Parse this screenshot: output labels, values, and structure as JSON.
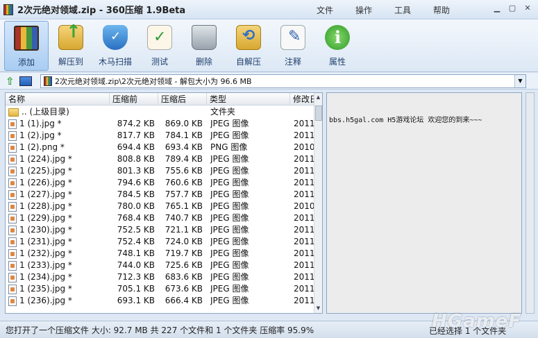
{
  "window": {
    "title": "2次元绝对领域.zip - 360压缩 1.9Beta"
  },
  "menu": [
    "文件",
    "操作",
    "工具",
    "帮助"
  ],
  "toolbar": [
    {
      "label": "添加",
      "icon": "add-archive-icon"
    },
    {
      "label": "解压到",
      "icon": "extract-folder-icon"
    },
    {
      "label": "木马扫描",
      "icon": "shield-scan-icon"
    },
    {
      "label": "测试",
      "icon": "test-checklist-icon"
    },
    {
      "label": "删除",
      "icon": "trash-can-icon"
    },
    {
      "label": "自解压",
      "icon": "self-extract-icon"
    },
    {
      "label": "注释",
      "icon": "comment-pen-icon"
    },
    {
      "label": "属性",
      "icon": "info-icon"
    }
  ],
  "address": {
    "path": "2次元绝对领域.zip\\2次元绝对领域 - 解包大小为 96.6 MB"
  },
  "list": {
    "columns": [
      "名称",
      "压缩前",
      "压缩后",
      "类型",
      "修改日"
    ],
    "rows": [
      {
        "name": ".. (上级目录)",
        "size": "",
        "packed": "",
        "type": "文件夹",
        "date": "",
        "folder": true
      },
      {
        "name": "1 (1).jpg *",
        "size": "874.2 KB",
        "packed": "869.0 KB",
        "type": "JPEG 图像",
        "date": "2011"
      },
      {
        "name": "1 (2).jpg *",
        "size": "817.7 KB",
        "packed": "784.1 KB",
        "type": "JPEG 图像",
        "date": "2011"
      },
      {
        "name": "1 (2).png *",
        "size": "694.4 KB",
        "packed": "693.4 KB",
        "type": "PNG 图像",
        "date": "2010"
      },
      {
        "name": "1 (224).jpg *",
        "size": "808.8 KB",
        "packed": "789.4 KB",
        "type": "JPEG 图像",
        "date": "2011"
      },
      {
        "name": "1 (225).jpg *",
        "size": "801.3 KB",
        "packed": "755.6 KB",
        "type": "JPEG 图像",
        "date": "2011"
      },
      {
        "name": "1 (226).jpg *",
        "size": "794.6 KB",
        "packed": "760.6 KB",
        "type": "JPEG 图像",
        "date": "2011"
      },
      {
        "name": "1 (227).jpg *",
        "size": "784.5 KB",
        "packed": "757.7 KB",
        "type": "JPEG 图像",
        "date": "2011"
      },
      {
        "name": "1 (228).jpg *",
        "size": "780.0 KB",
        "packed": "765.1 KB",
        "type": "JPEG 图像",
        "date": "2010"
      },
      {
        "name": "1 (229).jpg *",
        "size": "768.4 KB",
        "packed": "740.7 KB",
        "type": "JPEG 图像",
        "date": "2011"
      },
      {
        "name": "1 (230).jpg *",
        "size": "752.5 KB",
        "packed": "721.1 KB",
        "type": "JPEG 图像",
        "date": "2011"
      },
      {
        "name": "1 (231).jpg *",
        "size": "752.4 KB",
        "packed": "724.0 KB",
        "type": "JPEG 图像",
        "date": "2011"
      },
      {
        "name": "1 (232).jpg *",
        "size": "748.1 KB",
        "packed": "719.7 KB",
        "type": "JPEG 图像",
        "date": "2011"
      },
      {
        "name": "1 (233).jpg *",
        "size": "744.0 KB",
        "packed": "725.6 KB",
        "type": "JPEG 图像",
        "date": "2011"
      },
      {
        "name": "1 (234).jpg *",
        "size": "712.3 KB",
        "packed": "683.6 KB",
        "type": "JPEG 图像",
        "date": "2011"
      },
      {
        "name": "1 (235).jpg *",
        "size": "705.1 KB",
        "packed": "673.6 KB",
        "type": "JPEG 图像",
        "date": "2011"
      },
      {
        "name": "1 (236).jpg *",
        "size": "693.1 KB",
        "packed": "666.4 KB",
        "type": "JPEG 图像",
        "date": "2011"
      }
    ]
  },
  "comment": {
    "text": "bbs.h5gal.com  H5游戏论坛 欢迎您的到来~~~"
  },
  "status": {
    "left": "您打开了一个压缩文件 大小: 92.7 MB 共 227 个文件和 1 个文件夹 压缩率 95.9%",
    "right": "已经选择 1 个文件夹"
  },
  "watermark": "HGameF"
}
